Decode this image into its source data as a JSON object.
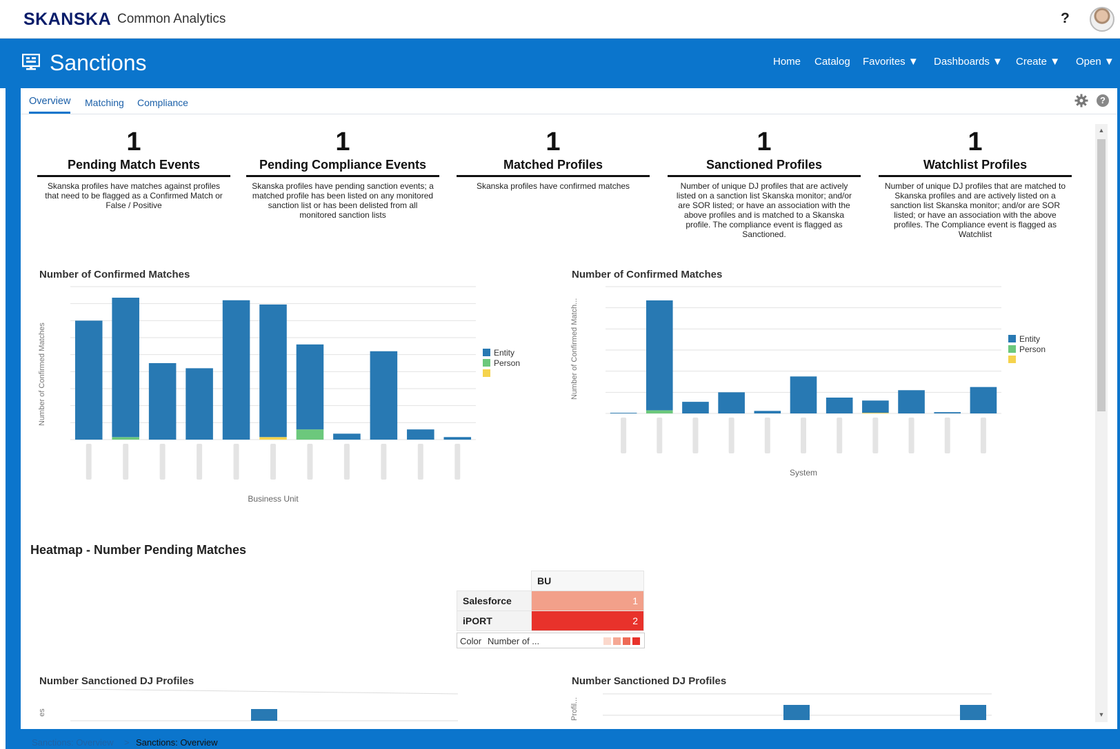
{
  "header": {
    "brand": "SKANSKA",
    "product": "Common Analytics",
    "help_label": "?"
  },
  "dashboard": {
    "title": "Sanctions",
    "icon": "dashboard-icon"
  },
  "nav": [
    {
      "label": "Home"
    },
    {
      "label": "Catalog"
    },
    {
      "label": "Favorites ▼"
    },
    {
      "label": "Dashboards ▼"
    },
    {
      "label": "Create ▼"
    },
    {
      "label": "Open ▼"
    }
  ],
  "tabs": [
    {
      "label": "Overview",
      "active": true
    },
    {
      "label": "Matching",
      "active": false
    },
    {
      "label": "Compliance",
      "active": false
    }
  ],
  "tools": {
    "settings_icon": "gear-icon",
    "help_icon": "help-circle-icon",
    "help_label": "?"
  },
  "kpis": [
    {
      "value": "1",
      "title": "Pending Match Events",
      "desc": "Skanska profiles have matches against profiles that need to be flagged as a Confirmed Match or False / Positive"
    },
    {
      "value": "1",
      "title": "Pending Compliance Events",
      "desc": "Skanska profiles have pending sanction events; a matched profile has been listed on any monitored sanction list or has been delisted from all monitored sanction lists"
    },
    {
      "value": "1",
      "title": "Matched Profiles",
      "desc": "Skanska profiles have confirmed matches"
    },
    {
      "value": "1",
      "title": "Sanctioned Profiles",
      "desc": "Number of unique DJ profiles that are actively listed on a sanction list Skanska monitor; and/or are SOR listed; or have an association with the above profiles and is matched to a Skanska profile. The compliance event is flagged as Sanctioned."
    },
    {
      "value": "1",
      "title": "Watchlist Profiles",
      "desc": "Number of unique DJ profiles that are matched to Skanska profiles and are actively listed on a sanction list Skanska monitor; and/or are SOR listed; or have an association with the above profiles. The Compliance event is flagged as Watchlist"
    }
  ],
  "chart_titles": {
    "left": "Number of Confirmed Matches",
    "right": "Number of Confirmed Matches",
    "bottom_left": "Number Sanctioned DJ Profiles",
    "bottom_right": "Number Sanctioned DJ Profiles"
  },
  "chart_data": [
    {
      "type": "bar",
      "title": "Number of Confirmed Matches",
      "xlabel": "Business Unit",
      "ylabel": "Number of Confirmed Matches",
      "legend": "right",
      "colors": {
        "Entity": "#2879b3",
        "Person": "#6cc87c",
        "Other": "#f5d34d"
      },
      "categories": [
        "",
        "",
        "",
        "",
        "",
        "",
        "",
        "",
        "",
        "",
        ""
      ],
      "ylim": [
        0,
        9
      ],
      "series": [
        {
          "name": "Entity",
          "values": [
            7.0,
            8.2,
            4.5,
            4.2,
            8.2,
            7.8,
            5.0,
            0.35,
            5.2,
            0.6,
            0.15
          ]
        },
        {
          "name": "Person",
          "values": [
            0,
            0.15,
            0,
            0,
            0,
            0,
            0.6,
            0,
            0,
            0,
            0
          ]
        },
        {
          "name": "",
          "values": [
            0,
            0,
            0,
            0,
            0,
            0.15,
            0,
            0,
            0,
            0,
            0
          ]
        }
      ]
    },
    {
      "type": "bar",
      "title": "Number of Confirmed Matches",
      "xlabel": "System",
      "ylabel": "Number of Confirmed Match...",
      "legend": "right",
      "colors": {
        "Entity": "#2879b3",
        "Person": "#6cc87c",
        "Other": "#f5d34d"
      },
      "categories": [
        "",
        "",
        "",
        "",
        "",
        "",
        "",
        "",
        "",
        "",
        ""
      ],
      "ylim": [
        0,
        6
      ],
      "series": [
        {
          "name": "Entity",
          "values": [
            0.03,
            5.2,
            0.55,
            1.0,
            0.12,
            1.75,
            0.75,
            0.58,
            1.1,
            0.06,
            1.25
          ]
        },
        {
          "name": "Person",
          "values": [
            0,
            0.15,
            0,
            0,
            0,
            0,
            0,
            0,
            0,
            0,
            0
          ]
        },
        {
          "name": "",
          "values": [
            0,
            0,
            0,
            0,
            0,
            0,
            0,
            0.03,
            0,
            0,
            0
          ]
        }
      ]
    }
  ],
  "heatmap": {
    "title": "Heatmap - Number Pending Matches",
    "column_header": "BU",
    "rows": [
      {
        "label": "Salesforce",
        "value": "1",
        "color": "#f2a08a"
      },
      {
        "label": "iPORT",
        "value": "2",
        "color": "#e8322b"
      }
    ],
    "legend_label": "Color",
    "legend_measure": "Number of ...",
    "legend_colors": [
      "#fbd8cc",
      "#f5a894",
      "#ee6a55",
      "#e8322b"
    ]
  },
  "bottom_charts": {
    "left_ylabel": "es",
    "right_ylabel": "Profil...",
    "bar_color": "#2879b3"
  },
  "breadcrumbs": [
    {
      "label": "Sanctions: Overview"
    },
    {
      "label": ">"
    },
    {
      "label": "Sanctions: Overview"
    }
  ]
}
